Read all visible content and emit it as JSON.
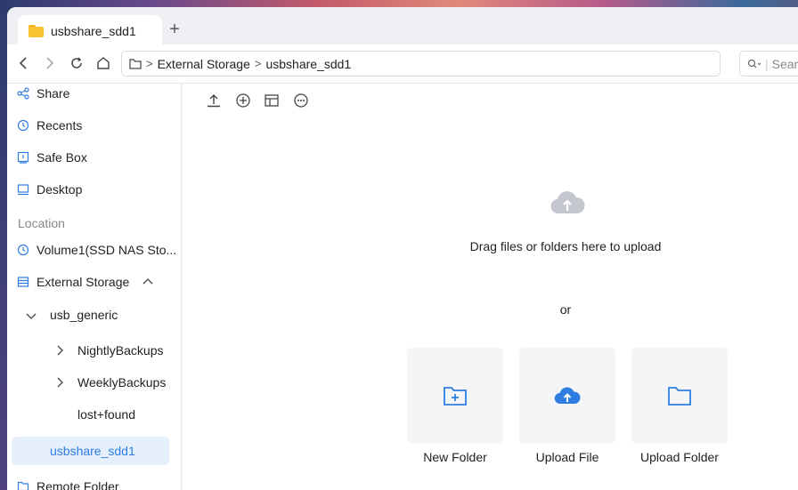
{
  "tab": {
    "title": "usbshare_sdd1",
    "new_tab": "+"
  },
  "address": {
    "parts": [
      "External Storage",
      "usbshare_sdd1"
    ]
  },
  "search": {
    "placeholder": "Sear"
  },
  "sidebar": {
    "items": [
      {
        "label": "Share",
        "icon": "share-icon"
      },
      {
        "label": "Recents",
        "icon": "clock-icon"
      },
      {
        "label": "Safe Box",
        "icon": "safe-box-icon"
      },
      {
        "label": "Desktop",
        "icon": "desktop-icon"
      }
    ],
    "location_label": "Location",
    "volume": "Volume1(SSD NAS Sto...",
    "external_storage": "External Storage",
    "usb_generic": "usb_generic",
    "nightly": "NightlyBackups",
    "weekly": "WeeklyBackups",
    "lost": "lost+found",
    "selected": "usbshare_sdd1",
    "remote": "Remote Folder"
  },
  "main": {
    "drag_text": "Drag files or folders here to upload",
    "or_text": "or",
    "cards": [
      "New Folder",
      "Upload File",
      "Upload Folder"
    ]
  },
  "colors": {
    "accent": "#2f7de1",
    "folder": "#f7c32e",
    "cloud": "#c5c8cf"
  }
}
